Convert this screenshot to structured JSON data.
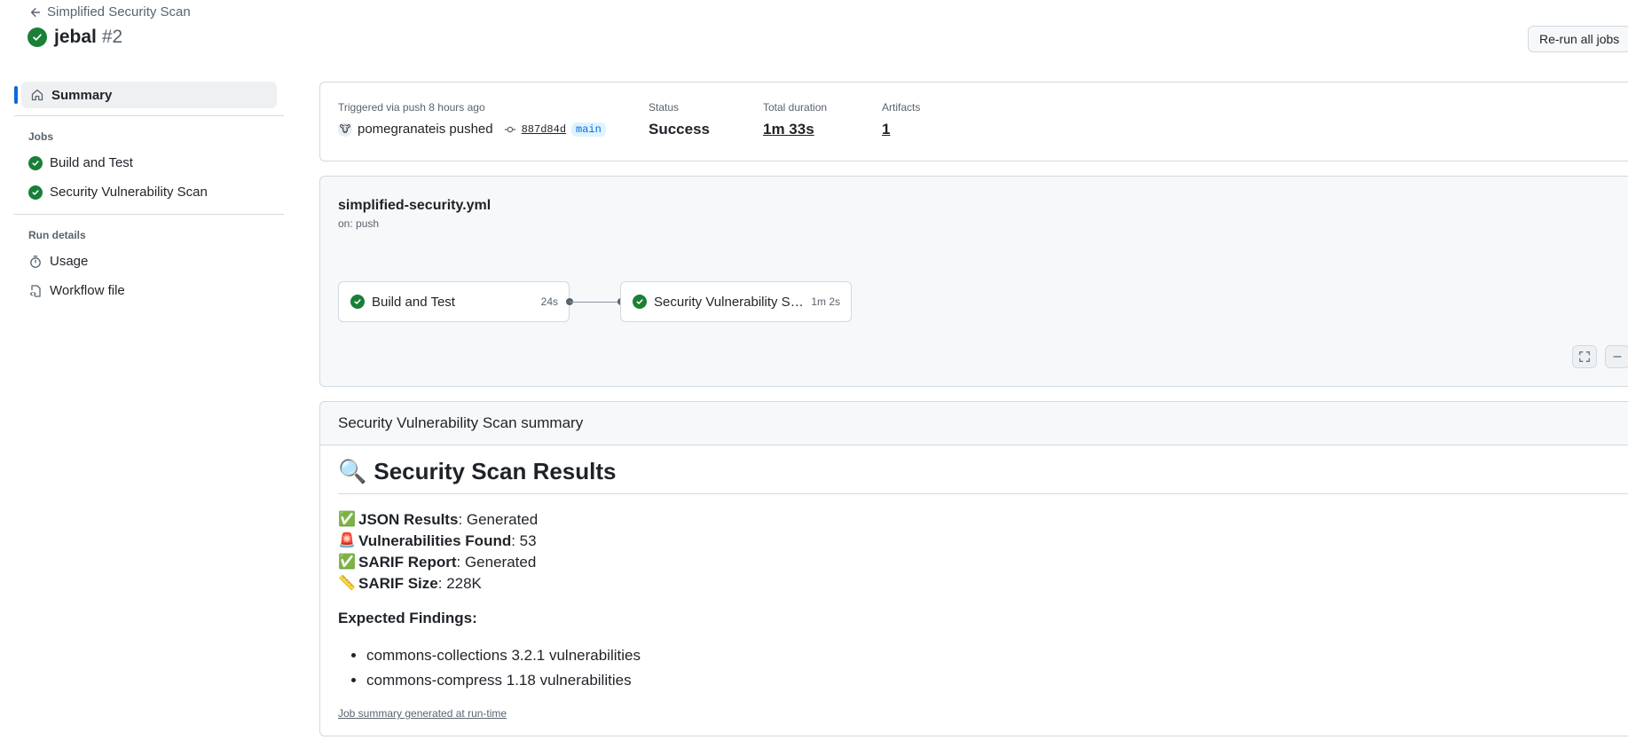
{
  "header": {
    "back_label": "Simplified Security Scan",
    "run_name": "jebal",
    "run_number": "#2",
    "rerun_label": "Re-run all jobs"
  },
  "sidebar": {
    "summary_label": "Summary",
    "jobs_heading": "Jobs",
    "jobs": [
      {
        "label": "Build and Test",
        "status": "success"
      },
      {
        "label": "Security Vulnerability Scan",
        "status": "success"
      }
    ],
    "run_details_heading": "Run details",
    "details": [
      {
        "label": "Usage",
        "icon": "stopwatch-icon"
      },
      {
        "label": "Workflow file",
        "icon": "file-code-icon"
      }
    ]
  },
  "info": {
    "trigger_text": "Triggered via push 8 hours ago",
    "avatar": "🐮",
    "actor_text": "pomegranateis pushed",
    "commit_sha": "887d84d",
    "branch": "main",
    "status_label": "Status",
    "status_value": "Success",
    "duration_label": "Total duration",
    "duration_value": "1m 33s",
    "artifacts_label": "Artifacts",
    "artifacts_value": "1"
  },
  "graph": {
    "workflow_file": "simplified-security.yml",
    "trigger": "on: push",
    "jobs": [
      {
        "label": "Build and Test",
        "duration": "24s"
      },
      {
        "label": "Security Vulnerability Scan",
        "duration": "1m 2s"
      }
    ]
  },
  "summary": {
    "header": "Security Vulnerability Scan summary",
    "h1_emoji": "🔍",
    "h1_text": "Security Scan Results",
    "lines": [
      {
        "emoji": "✅",
        "key": "JSON Results",
        "value": ": Generated"
      },
      {
        "emoji": "🚨",
        "key": "Vulnerabilities Found",
        "value": ": 53"
      },
      {
        "emoji": "✅",
        "key": "SARIF Report",
        "value": ": Generated"
      },
      {
        "emoji": "📏",
        "key": "SARIF Size",
        "value": ": 228K"
      }
    ],
    "expected_heading": "Expected Findings:",
    "findings": [
      "commons-collections 3.2.1 vulnerabilities",
      "commons-compress 1.18 vulnerabilities"
    ],
    "footer": "Job summary generated at run-time"
  },
  "colors": {
    "success": "#1a7f37",
    "accent": "#0969da",
    "border": "#d1d9e0",
    "muted": "#59636e"
  }
}
